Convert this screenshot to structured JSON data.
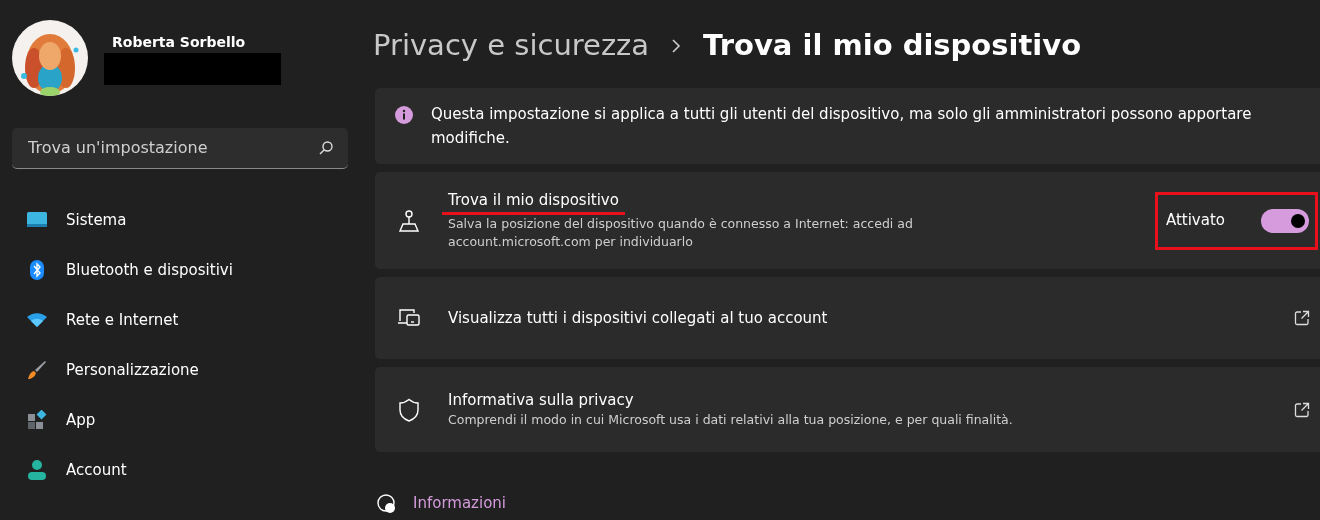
{
  "user": {
    "name": "Roberta Sorbello",
    "email_redacted": true
  },
  "search": {
    "placeholder": "Trova un'impostazione"
  },
  "sidebar": {
    "items": [
      {
        "label": "Sistema",
        "kind": "system",
        "selected": false
      },
      {
        "label": "Bluetooth e dispositivi",
        "kind": "bluetooth",
        "selected": false
      },
      {
        "label": "Rete e Internet",
        "kind": "network",
        "selected": false
      },
      {
        "label": "Personalizzazione",
        "kind": "brush",
        "selected": false
      },
      {
        "label": "App",
        "kind": "apps",
        "selected": false
      },
      {
        "label": "Account",
        "kind": "account",
        "selected": false
      }
    ]
  },
  "breadcrumb": [
    {
      "label": "Privacy e sicurezza",
      "current": false
    },
    {
      "label": "Trova il mio dispositivo",
      "current": true
    }
  ],
  "notice": {
    "text": "Questa impostazione si applica a tutti gli utenti del dispositivo, ma solo gli amministratori possono apportare modifiche."
  },
  "cards": [
    {
      "kind": "toggle",
      "title": "Trova il mio dispositivo",
      "description": "Salva la posizione del dispositivo quando è connesso a Internet: accedi ad account.microsoft.com per individuarlo",
      "state_label": "Attivato",
      "on": true,
      "highlighted": true
    },
    {
      "kind": "link",
      "title": "Visualizza tutti i dispositivi collegati al tuo account",
      "highlighted": false
    },
    {
      "kind": "link",
      "title": "Informativa sulla privacy",
      "description": "Comprendi il modo in cui Microsoft usa i dati relativi alla tua posizione, e per quali finalità.",
      "highlighted": false
    }
  ],
  "footer_link": {
    "label": "Informazioni"
  }
}
